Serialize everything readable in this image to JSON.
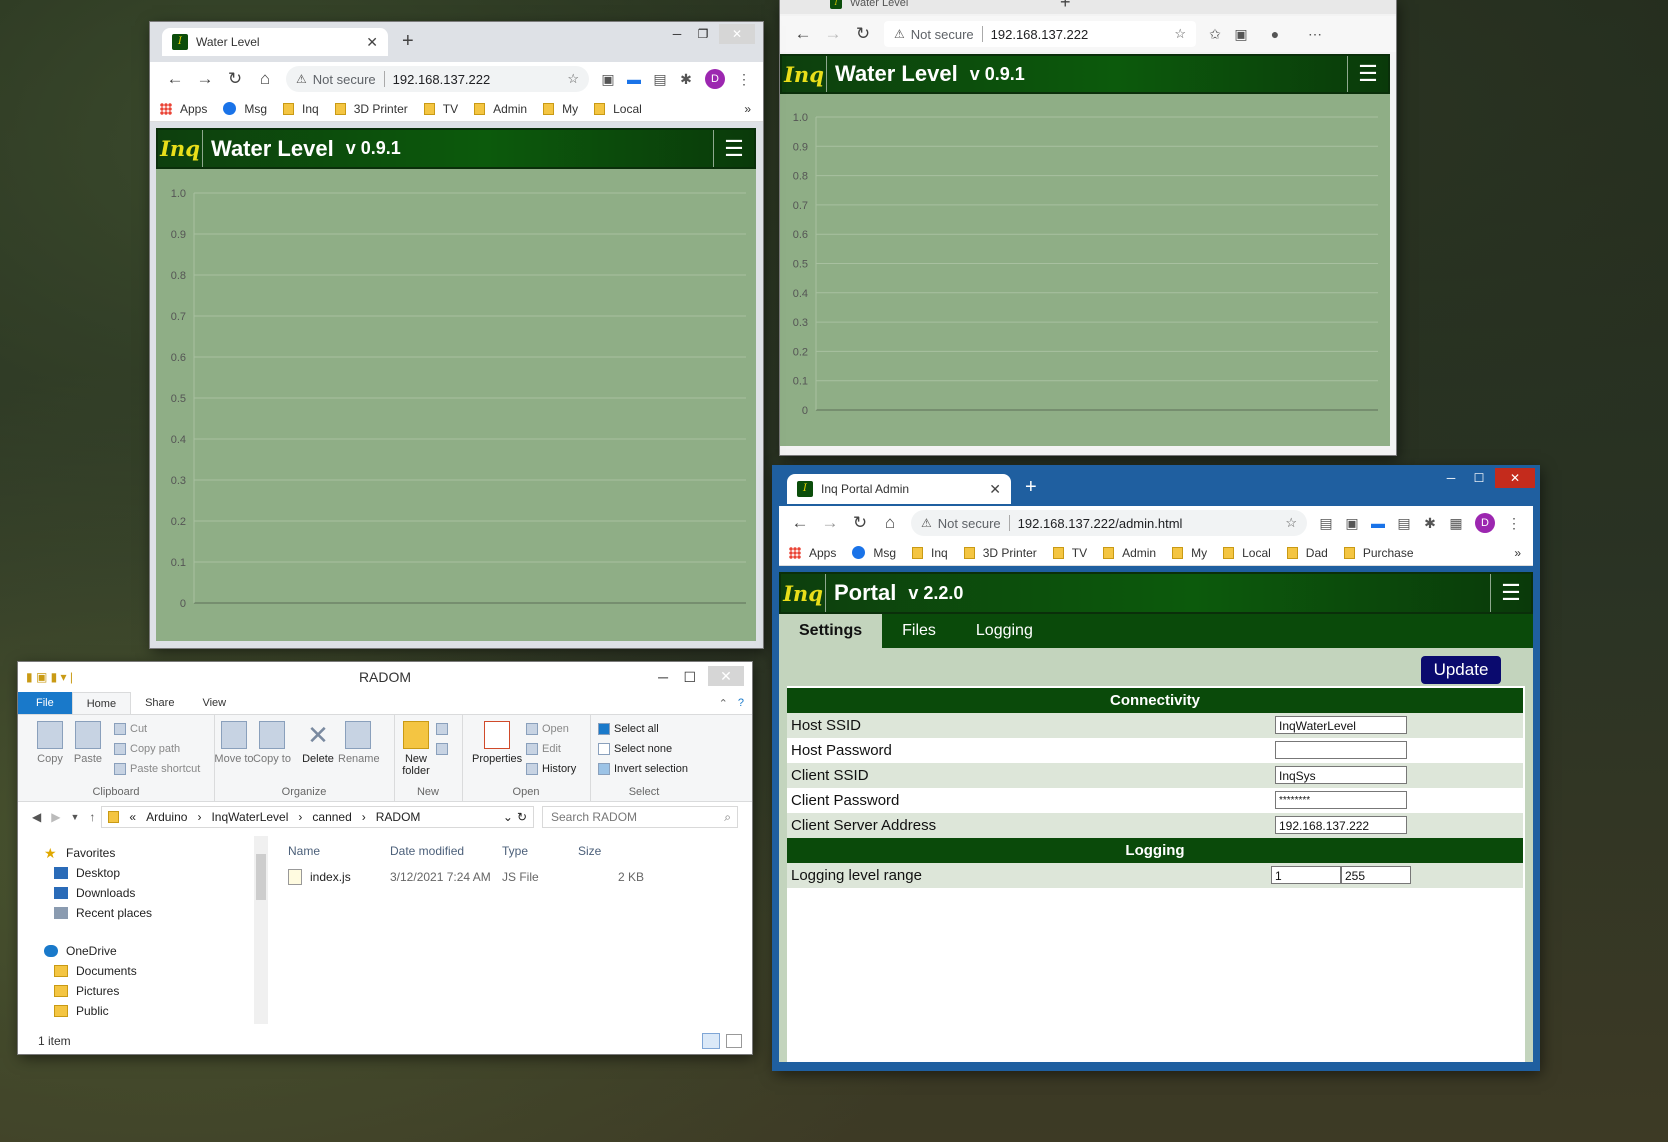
{
  "window1": {
    "tab_title": "Water Level",
    "not_secure": "Not secure",
    "url": "192.168.137.222",
    "bookmarks": [
      "Apps",
      "Msg",
      "Inq",
      "3D Printer",
      "TV",
      "Admin",
      "My",
      "Local"
    ],
    "bookmarks_more": "»",
    "avatar_letter": "D",
    "app_logo": "Inq",
    "app_title": "Water Level",
    "app_version": "v 0.9.1",
    "y_ticks": [
      "1.0",
      "0.9",
      "0.8",
      "0.7",
      "0.6",
      "0.5",
      "0.4",
      "0.3",
      "0.2",
      "0.1",
      "0"
    ]
  },
  "window2": {
    "tab_title": "Water Level",
    "not_secure": "Not secure",
    "url": "192.168.137.222",
    "app_logo": "Inq",
    "app_title": "Water Level",
    "app_version": "v 0.9.1",
    "y_ticks": [
      "1.0",
      "0.9",
      "0.8",
      "0.7",
      "0.6",
      "0.5",
      "0.4",
      "0.3",
      "0.2",
      "0.1",
      "0"
    ]
  },
  "explorer": {
    "title": "RADOM",
    "ribbon_tabs": [
      "File",
      "Home",
      "Share",
      "View"
    ],
    "clipboard": {
      "copy": "Copy",
      "paste": "Paste",
      "cut": "Cut",
      "copy_path": "Copy path",
      "paste_shortcut": "Paste shortcut",
      "label": "Clipboard"
    },
    "organize": {
      "move_to": "Move to",
      "copy_to": "Copy to",
      "delete": "Delete",
      "rename": "Rename",
      "label": "Organize"
    },
    "new": {
      "new_folder": "New folder",
      "label": "New"
    },
    "open": {
      "properties": "Properties",
      "open": "Open",
      "edit": "Edit",
      "history": "History",
      "label": "Open"
    },
    "select": {
      "select_all": "Select all",
      "select_none": "Select none",
      "invert": "Invert selection",
      "label": "Select"
    },
    "path": [
      "«",
      "Arduino",
      "InqWaterLevel",
      "canned",
      "RADOM"
    ],
    "search_placeholder": "Search RADOM",
    "nav": {
      "favorites": "Favorites",
      "desktop": "Desktop",
      "downloads": "Downloads",
      "recent": "Recent places",
      "onedrive": "OneDrive",
      "documents": "Documents",
      "pictures": "Pictures",
      "public": "Public"
    },
    "columns": {
      "name": "Name",
      "date": "Date modified",
      "type": "Type",
      "size": "Size"
    },
    "files": [
      {
        "name": "index.js",
        "date": "3/12/2021 7:24 AM",
        "type": "JS File",
        "size": "2 KB"
      }
    ],
    "status": "1 item"
  },
  "portal": {
    "tab_title": "Inq Portal Admin",
    "not_secure": "Not secure",
    "url": "192.168.137.222/admin.html",
    "bookmarks": [
      "Apps",
      "Msg",
      "Inq",
      "3D Printer",
      "TV",
      "Admin",
      "My",
      "Local",
      "Dad",
      "Purchase"
    ],
    "bookmarks_more": "»",
    "avatar_letter": "D",
    "app_logo": "Inq",
    "app_title": "Portal",
    "app_version": "v 2.2.0",
    "tabs": [
      "Settings",
      "Files",
      "Logging"
    ],
    "update_label": "Update",
    "connectivity_header": "Connectivity",
    "fields": [
      {
        "label": "Host SSID",
        "value": "InqWaterLevel"
      },
      {
        "label": "Host Password",
        "value": ""
      },
      {
        "label": "Client SSID",
        "value": "InqSys"
      },
      {
        "label": "Client Password",
        "value": "********"
      },
      {
        "label": "Client Server Address",
        "value": "192.168.137.222"
      }
    ],
    "logging_header": "Logging",
    "logging_label": "Logging level range",
    "logging_min": "1",
    "logging_max": "255"
  },
  "colors": {
    "header_green": "#0c5a0c",
    "chart_bg": "#8fae86",
    "update_blue": "#0a0a6e",
    "row_alt": "#dde6d9"
  }
}
